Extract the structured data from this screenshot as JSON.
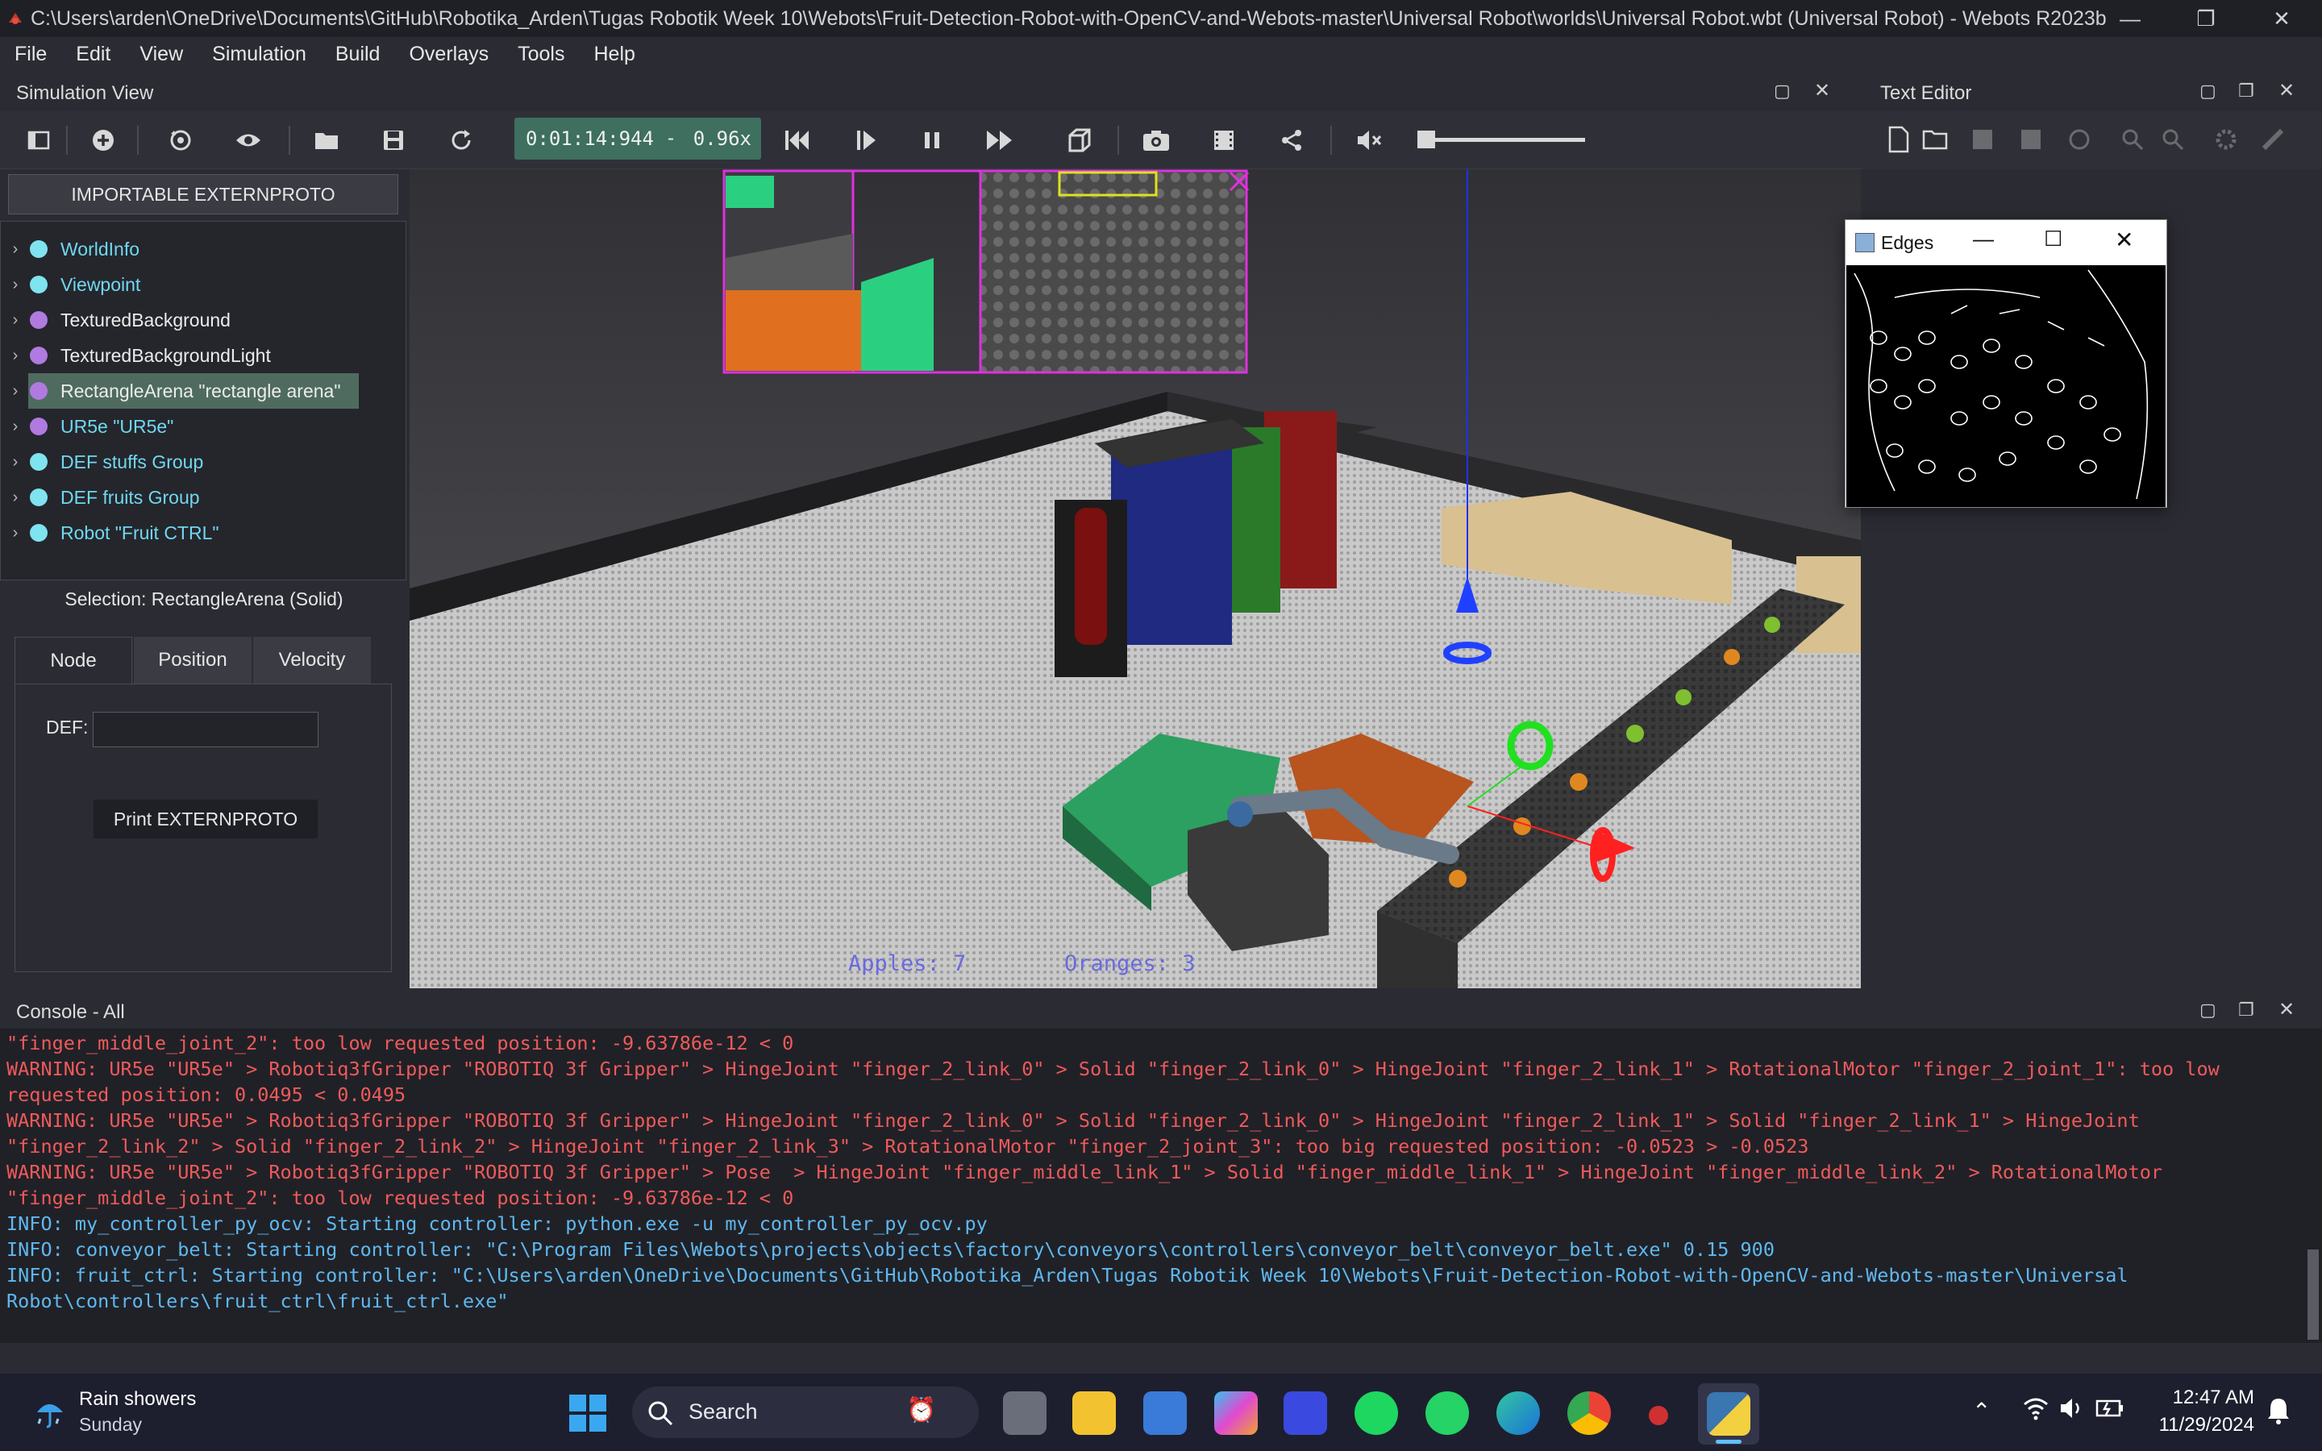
{
  "window": {
    "title": "C:\\Users\\arden\\OneDrive\\Documents\\GitHub\\Robotika_Arden\\Tugas Robotik Week 10\\Webots\\Fruit-Detection-Robot-with-OpenCV-and-Webots-master\\Universal Robot\\worlds\\Universal Robot.wbt (Universal Robot) - Webots R2023b",
    "minimize": "—",
    "maximize": "❐",
    "close": "✕"
  },
  "menu": [
    "File",
    "Edit",
    "View",
    "Simulation",
    "Build",
    "Overlays",
    "Tools",
    "Help"
  ],
  "simulation_view": {
    "title": "Simulation View",
    "time": "0:01:14:944",
    "time_sep": "-",
    "speed": "0.96x"
  },
  "text_editor": {
    "title": "Text Editor"
  },
  "scene_tree": {
    "import_button": "IMPORTABLE EXTERNPROTO",
    "items": [
      {
        "label": "WorldInfo",
        "color": "#6fd8f0",
        "dot": "#7fe3f0"
      },
      {
        "label": "Viewpoint",
        "color": "#6fd8f0",
        "dot": "#7fe3f0"
      },
      {
        "label": "TexturedBackground",
        "color": "#ececec",
        "dot": "#b07ae0"
      },
      {
        "label": "TexturedBackgroundLight",
        "color": "#ececec",
        "dot": "#b07ae0"
      },
      {
        "label": "RectangleArena \"rectangle arena\"",
        "color": "#ececec",
        "dot": "#b07ae0"
      },
      {
        "label": "UR5e \"UR5e\"",
        "color": "#6fd8f0",
        "dot": "#b07ae0"
      },
      {
        "label": "DEF stuffs Group",
        "color": "#6fd8f0",
        "dot": "#7fe3f0"
      },
      {
        "label": "DEF fruits Group",
        "color": "#6fd8f0",
        "dot": "#7fe3f0"
      },
      {
        "label": "Robot \"Fruit CTRL\"",
        "color": "#6fd8f0",
        "dot": "#7fe3f0"
      }
    ]
  },
  "properties": {
    "selection": "Selection: RectangleArena (Solid)",
    "tabs": [
      "Node",
      "Position",
      "Velocity"
    ],
    "def_label": "DEF:",
    "def_value": "",
    "print_button": "Print EXTERNPROTO"
  },
  "overlay": {
    "apples": "Apples: 7",
    "oranges": "Oranges: 3"
  },
  "edges_window": {
    "title": "Edges"
  },
  "console": {
    "title": "Console - All",
    "lines": [
      {
        "type": "warn",
        "text": "\"finger_middle_joint_2\": too low requested position: -9.63786e-12 < 0"
      },
      {
        "type": "warn",
        "text": "WARNING: UR5e \"UR5e\" > Robotiq3fGripper \"ROBOTIQ 3f Gripper\" > HingeJoint \"finger_2_link_0\" > Solid \"finger_2_link_0\" > HingeJoint \"finger_2_link_1\" > RotationalMotor \"finger_2_joint_1\": too low"
      },
      {
        "type": "warn",
        "text": "requested position: 0.0495 < 0.0495"
      },
      {
        "type": "warn",
        "text": "WARNING: UR5e \"UR5e\" > Robotiq3fGripper \"ROBOTIQ 3f Gripper\" > HingeJoint \"finger_2_link_0\" > Solid \"finger_2_link_0\" > HingeJoint \"finger_2_link_1\" > Solid \"finger_2_link_1\" > HingeJoint"
      },
      {
        "type": "warn",
        "text": "\"finger_2_link_2\" > Solid \"finger_2_link_2\" > HingeJoint \"finger_2_link_3\" > RotationalMotor \"finger_2_joint_3\": too big requested position: -0.0523 > -0.0523"
      },
      {
        "type": "warn",
        "text": "WARNING: UR5e \"UR5e\" > Robotiq3fGripper \"ROBOTIQ 3f Gripper\" > Pose  > HingeJoint \"finger_middle_link_1\" > Solid \"finger_middle_link_1\" > HingeJoint \"finger_middle_link_2\" > RotationalMotor"
      },
      {
        "type": "warn",
        "text": "\"finger_middle_joint_2\": too low requested position: -9.63786e-12 < 0"
      },
      {
        "type": "info",
        "text": "INFO: my_controller_py_ocv: Starting controller: python.exe -u my_controller_py_ocv.py"
      },
      {
        "type": "info",
        "text": "INFO: conveyor_belt: Starting controller: \"C:\\Program Files\\Webots\\projects\\objects\\factory\\conveyors\\controllers\\conveyor_belt\\conveyor_belt.exe\" 0.15 900"
      },
      {
        "type": "info",
        "text": "INFO: fruit_ctrl: Starting controller: \"C:\\Users\\arden\\OneDrive\\Documents\\GitHub\\Robotika_Arden\\Tugas Robotik Week 10\\Webots\\Fruit-Detection-Robot-with-OpenCV-and-Webots-master\\Universal"
      },
      {
        "type": "info",
        "text": "Robot\\controllers\\fruit_ctrl\\fruit_ctrl.exe\""
      }
    ]
  },
  "taskbar": {
    "weather_title": "Rain showers",
    "weather_sub": "Sunday",
    "search_placeholder": "Search",
    "time": "12:47 AM",
    "date": "11/29/2024"
  }
}
